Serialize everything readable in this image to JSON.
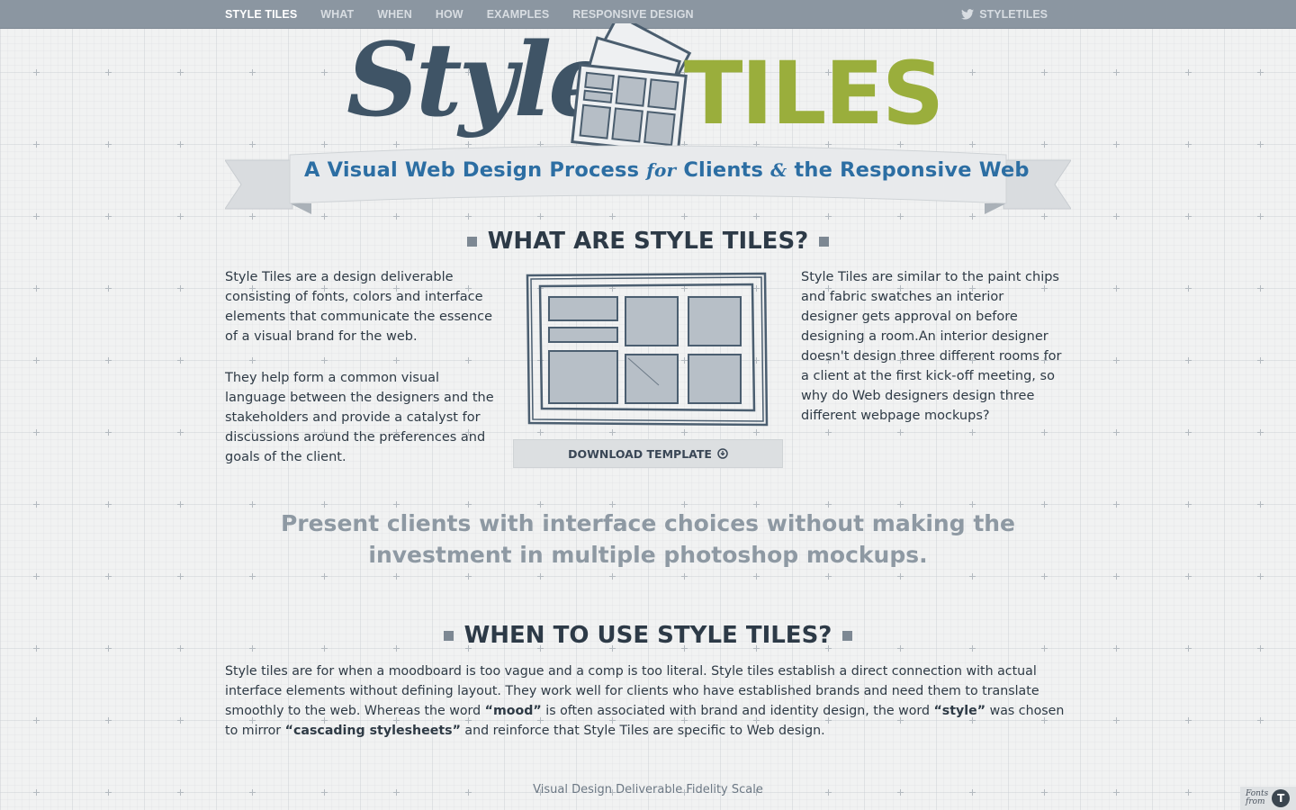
{
  "nav": {
    "items": [
      {
        "label": "STYLE TILES",
        "active": true
      },
      {
        "label": "WHAT",
        "active": false
      },
      {
        "label": "WHEN",
        "active": false
      },
      {
        "label": "HOW",
        "active": false
      },
      {
        "label": "EXAMPLES",
        "active": false
      },
      {
        "label": "RESPONSIVE DESIGN",
        "active": false
      }
    ],
    "twitter_label": "STYLETILES",
    "twitter_icon": "twitter-bird-icon"
  },
  "logo": {
    "style_word": "Style",
    "tiles_word": "TILES"
  },
  "tagline": {
    "part1": "A Visual Web Design Process ",
    "for_word": "for",
    "part2": " Clients ",
    "amp": "&",
    "part3": " the Responsive Web"
  },
  "what": {
    "heading": "WHAT ARE STYLE TILES?",
    "left_para1": "Style Tiles are a design deliverable consisting of fonts, colors and interface elements that communicate the essence of a visual brand for the web.",
    "left_para2": "They help form a common visual language between the designers and the stakeholders and provide a catalyst for discussions around the preferences and goals of the client.",
    "right_para": "Style Tiles are similar to the paint chips and fabric swatches an interior designer gets approval on before designing a room.An interior designer doesn't design three different rooms for a client at the first kick-off meeting, so why do Web designers design three different webpage mockups?",
    "download_label": "DOWNLOAD TEMPLATE",
    "download_icon": "arrow-circle-icon"
  },
  "pullquote": {
    "line1": "Present clients with interface choices without making the",
    "line2": "investment in multiple photoshop mockups."
  },
  "when": {
    "heading": "WHEN TO USE STYLE TILES?",
    "text_a": "Style tiles are for when a moodboard is too vague and a comp is too literal. Style tiles establish a direct connection with actual interface elements without defining layout. They work well for clients who have established brands and need them to translate smoothly to the web. Whereas the word ",
    "bold_mood": "“mood”",
    "text_b": " is often associated with brand and identity design, the word ",
    "bold_style": "“style”",
    "text_c": " was chosen to mirror ",
    "bold_css": "“cascading stylesheets”",
    "text_d": " and reinforce that Style Tiles are specific to Web design."
  },
  "footer": {
    "link_label": "Visual Design Deliverable Fidelity Scale",
    "fonts_badge_line1": "Fonts",
    "fonts_badge_line2": "from",
    "fonts_badge_logo": "T"
  },
  "colors": {
    "nav_bg": "#8b96a1",
    "logo_blue": "#3f5466",
    "logo_green": "#9aae3c",
    "tagline_blue": "#2c6ea3",
    "heading": "#2d3a47",
    "pullquote": "#8e99a3"
  }
}
